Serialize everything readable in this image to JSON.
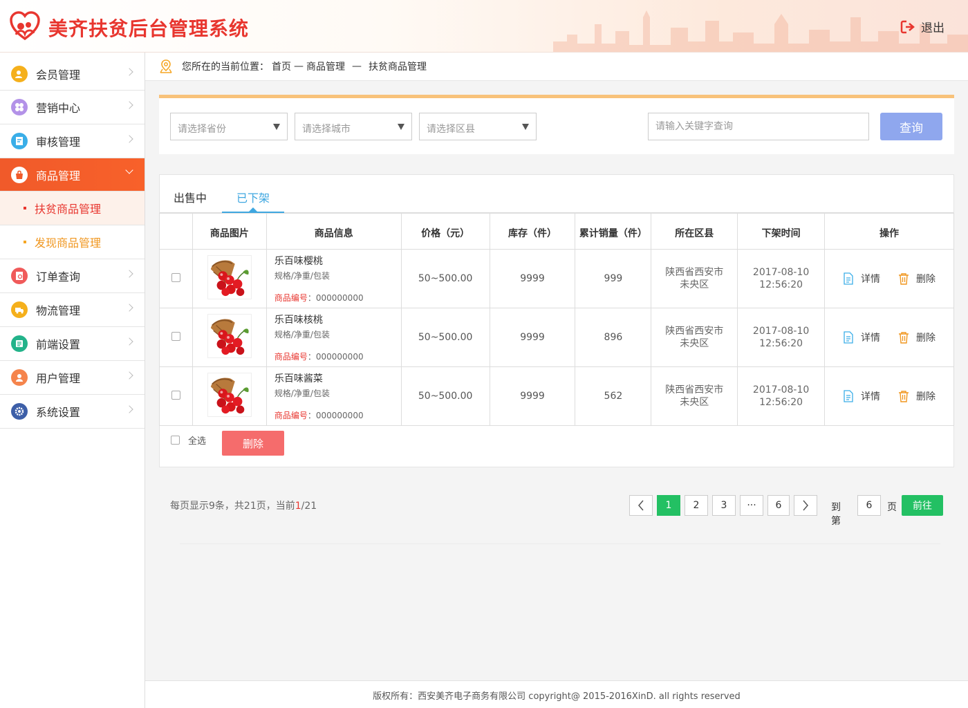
{
  "header": {
    "title": "美齐扶贫后台管理系统",
    "logout": "退出"
  },
  "sidebar": {
    "items": [
      {
        "label": "会员管理",
        "icon": "member-icon",
        "color": "#f5b01c"
      },
      {
        "label": "营销中心",
        "icon": "marketing-icon",
        "color": "#b392e8"
      },
      {
        "label": "审核管理",
        "icon": "audit-icon",
        "color": "#3aaee8"
      },
      {
        "label": "商品管理",
        "icon": "goods-icon",
        "color": "#ffffff"
      }
    ],
    "sub_items": [
      {
        "label": "扶贫商品管理"
      },
      {
        "label": "发现商品管理"
      }
    ],
    "items_after": [
      {
        "label": "订单查询",
        "icon": "order-icon",
        "color": "#f05a5a"
      },
      {
        "label": "物流管理",
        "icon": "logistics-icon",
        "color": "#f5b01c"
      },
      {
        "label": "前端设置",
        "icon": "frontend-icon",
        "color": "#23b38a"
      },
      {
        "label": "用户管理",
        "icon": "user-icon",
        "color": "#f5844c"
      },
      {
        "label": "系统设置",
        "icon": "settings-icon",
        "color": "#3d5fa8"
      }
    ]
  },
  "breadcrumb": {
    "prefix": "您所在的当前位置：",
    "home": "首页",
    "sep1": "—",
    "section": "商品管理",
    "sep2": "—",
    "page": "扶贫商品管理"
  },
  "filters": {
    "province": "请选择省份",
    "city": "请选择城市",
    "district": "请选择区县",
    "keyword_placeholder": "请输入关键字查询",
    "query_label": "查询"
  },
  "tabs": [
    {
      "label": "出售中"
    },
    {
      "label": "已下架",
      "active": true
    }
  ],
  "table": {
    "headers": [
      "商品图片",
      "商品信息",
      "价格（元）",
      "库存（件）",
      "累计销量（件）",
      "所在区县",
      "下架时间",
      "操作"
    ],
    "rows": [
      {
        "name": "乐百味樱桃",
        "spec": "规格/净重/包装",
        "code_label": "商品编号",
        "code": "：000000000",
        "price": "50~500.00",
        "stock": "9999",
        "sales": "999",
        "region_1": "陕西省西安市",
        "region_2": "未央区",
        "date": "2017-08-10",
        "time": "12:56:20",
        "detail": "详情",
        "delete": "删除"
      },
      {
        "name": "乐百味核桃",
        "spec": "规格/净重/包装",
        "code_label": "商品编号",
        "code": "：000000000",
        "price": "50~500.00",
        "stock": "9999",
        "sales": "896",
        "region_1": "陕西省西安市",
        "region_2": "未央区",
        "date": "2017-08-10",
        "time": "12:56:20",
        "detail": "详情",
        "delete": "删除"
      },
      {
        "name": "乐百味酱菜",
        "spec": "规格/净重/包装",
        "code_label": "商品编号",
        "code": "：000000000",
        "price": "50~500.00",
        "stock": "9999",
        "sales": "562",
        "region_1": "陕西省西安市",
        "region_2": "未央区",
        "date": "2017-08-10",
        "time": "12:56:20",
        "detail": "详情",
        "delete": "删除"
      }
    ]
  },
  "bulk": {
    "select_all": "全选",
    "delete": "删除"
  },
  "pagination": {
    "info_prefix": "每页显示9条，共21页，当前",
    "current": "1",
    "info_suffix": "/21",
    "pages": [
      "1",
      "2",
      "3",
      "···",
      "6"
    ],
    "goto_label": "到第",
    "goto_value": "6",
    "page_unit": "页",
    "go_label": "前往"
  },
  "footer": {
    "text": "版权所有：西安美齐电子商务有限公司 copyright@ 2015-2016XinD. all rights reserved"
  },
  "colors": {
    "brand": "#e8362f",
    "accent": "#f05a2a",
    "tab_active": "#3fa7e0",
    "pager_active": "#23c063",
    "query": "#8fa7ee",
    "delete": "#f56c6c"
  }
}
